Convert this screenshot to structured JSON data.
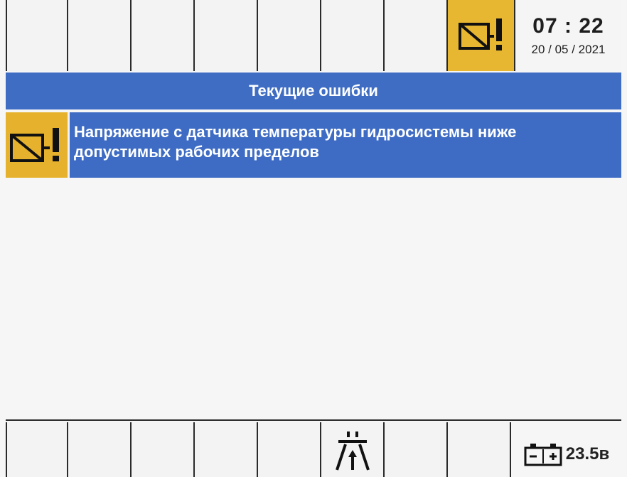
{
  "status_bar": {
    "alarm_icon": "sensor-warning-icon",
    "time": "07 : 22",
    "date": "20 / 05 / 2021"
  },
  "title": "Текущие ошибки",
  "errors": [
    {
      "icon": "sensor-warning-icon",
      "message": "Напряжение с датчика температуры гидросистемы ниже допустимых рабочих пределов"
    }
  ],
  "bottom_bar": {
    "road_icon": "road-lane-icon",
    "battery_icon": "battery-icon",
    "battery_voltage": "23.5в"
  },
  "colors": {
    "header_blue": "#3f6dc3",
    "warning_yellow": "#e6b22e",
    "text_white": "#ffffff",
    "grid_line": "#2a2a2a"
  }
}
